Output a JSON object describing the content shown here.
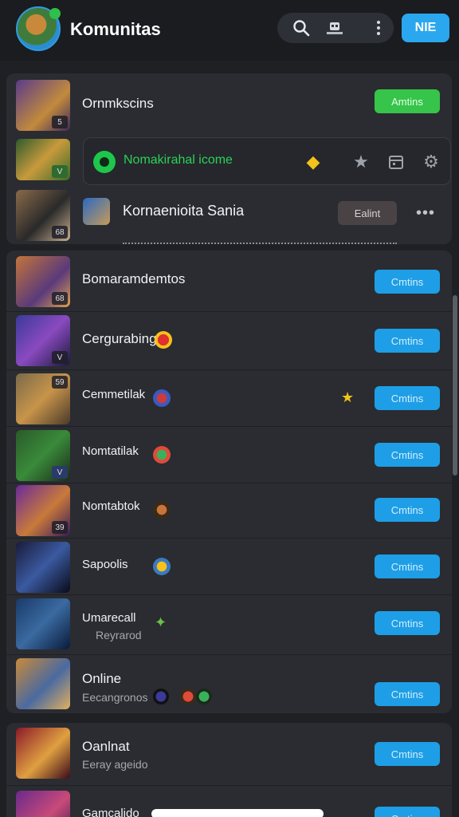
{
  "header": {
    "title": "Komunitas",
    "icons": [
      "search-icon",
      "robot-icon",
      "more-vertical-icon"
    ],
    "primary_button": "NIE",
    "accent_color": "#2aa7ee"
  },
  "top_section": {
    "row1": {
      "title": "Ornmkscins",
      "badge": "5",
      "button": "Amtins",
      "button_color": "#36c44a"
    },
    "row2": {
      "badge": "V",
      "highlight_text": "Nomakirahal icome",
      "icons": [
        "diamond-icon",
        "star-icon",
        "calendar-icon",
        "gear-icon"
      ]
    },
    "row3": {
      "title": "Kornaenioita Sania",
      "badge": "68",
      "button": "Ealint",
      "more": "•••"
    }
  },
  "list": [
    {
      "title": "Bomaramdemtos",
      "subtitle": "",
      "badge": "68",
      "button": "Cmtins"
    },
    {
      "title": "Cergurabingr",
      "subtitle": "",
      "badge": "V",
      "button": "Cmtins"
    },
    {
      "title": "Cemmetilak",
      "subtitle": "",
      "badge": "59",
      "button": "Cmtins"
    },
    {
      "title": "Nomtatilak",
      "subtitle": "",
      "badge": "V",
      "button": "Cmtins"
    },
    {
      "title": "Nomtabtok",
      "subtitle": "",
      "badge": "39",
      "button": "Cmtins"
    },
    {
      "title": "Sapoolis",
      "subtitle": "",
      "badge": "",
      "button": "Cmtins"
    },
    {
      "title": "Umarecall",
      "subtitle": "Reyrarod",
      "badge": "",
      "button": "Cmtins"
    },
    {
      "title": "Online",
      "subtitle": "Eecangronos",
      "badge": "",
      "button": "Cmtins"
    }
  ],
  "bottom_list": [
    {
      "title": "Oanlnat",
      "subtitle": "Eeray ageido",
      "button": "Cmtins"
    },
    {
      "title": "Gamcalido",
      "subtitle": "",
      "button": "Cmtins"
    }
  ]
}
